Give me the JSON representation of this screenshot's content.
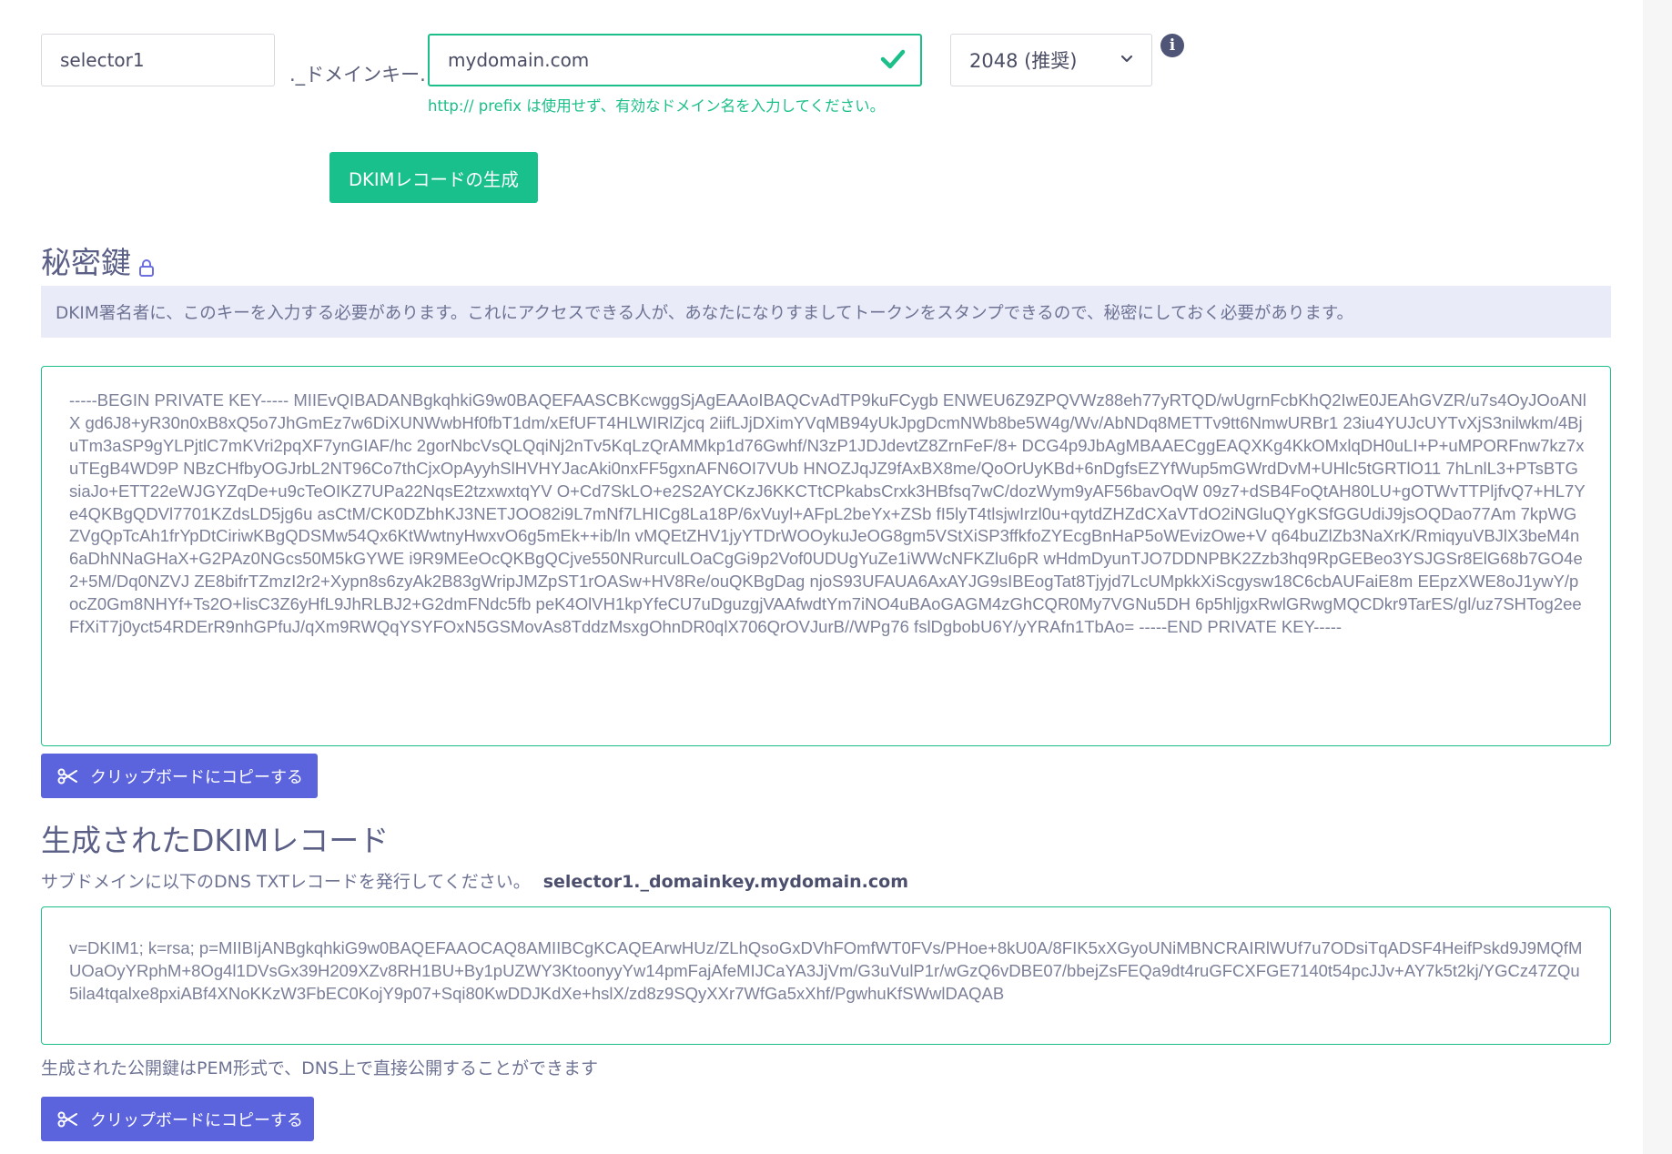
{
  "form": {
    "selector_value": "selector1",
    "domainkey_suffix": "._ドメインキー.",
    "domain_value": "mydomain.com",
    "domain_hint": "http:// prefix は使用せず、有効なドメイン名を入力してください。",
    "key_size_selected": "2048 (推奨)",
    "info_icon_glyph": "i",
    "generate_button_label": "DKIMレコードの生成"
  },
  "private_key_section": {
    "title": "秘密鍵",
    "notice": "DKIM署名者に、このキーを入力する必要があります。これにアクセスできる人が、あなたになりすましてトークンをスタンプできるので、秘密にしておく必要があります。",
    "key_text": "-----BEGIN PRIVATE KEY----- MIIEvQIBADANBgkqhkiG9w0BAQEFAASCBKcwggSjAgEAAoIBAQCvAdTP9kuFCygb ENWEU6Z9ZPQVWz88eh77yRTQD/wUgrnFcbKhQ2IwE0JEAhGVZR/u7s4OyJOoANlX gd6J8+yR30n0xB8xQ5o7JhGmEz7w6DiXUNWwbHf0fbT1dm/xEfUFT4HLWIRlZjcq 2iifLJjDXimYVqMB94yUkJpgDcmNWb8be5W4g/Wv/AbNDq8METTv9tt6NmwURBr1 23iu4YUJcUYTvXjS3nilwkm/4BjuTm3aSP9gYLPjtlC7mKVri2pqXF7ynGIAF/hc 2gorNbcVsQLQqiNj2nTv5KqLzQrAMMkp1d76Gwhf/N3zP1JDJdevtZ8ZrnFeF/8+ DCG4p9JbAgMBAAECggEAQXKg4KkOMxlqDH0uLI+P+uMPORFnw7kz7xuTEgB4WD9P NBzCHfbyOGJrbL2NT96Co7thCjxOpAyyhSlHVHYJacAki0nxFF5gxnAFN6OI7VUb HNOZJqJZ9fAxBX8me/QoOrUyKBd+6nDgfsEZYfWup5mGWrdDvM+UHlc5tGRTlO11 7hLnlL3+PTsBTGsiaJo+ETT22eWJGYZqDe+u9cTeOIKZ7UPa22NqsE2tzxwxtqYV O+Cd7SkLO+e2S2AYCKzJ6KKCTtCPkabsCrxk3HBfsq7wC/dozWym9yAF56bavOqW 09z7+dSB4FoQtAH80LU+gOTWvTTPljfvQ7+HL7Ye4QKBgQDVl7701KZdsLD5jg6u asCtM/CK0DZbhKJ3NETJOO82i9L7mNf7LHICg8La18P/6xVuyl+AFpL2beYx+ZSb fI5lyT4tlsjwIrzl0u+qytdZHZdCXaVTdO2iNGluQYgKSfGGUdiJ9jsOQDao77Am 7kpWGZVgQpTcAh1frYpDtCiriwKBgQDSMw54Qx6KtWwtnyHwxvO6g5mEk++ib/ln vMQEtZHV1jyYTDrWOOykuJeOG8gm5VStXiSP3ffkfoZYEcgBnHaP5oWEvizOwe+V q64buZlZb3NaXrK/RmiqyuVBJlX3beM4n6aDhNNaGHaX+G2PAz0NGcs50M5kGYWE i9R9MEeOcQKBgQCjve550NRurculLOaCgGi9p2Vof0UDUgYuZe1iWWcNFKZlu6pR wHdmDyunTJO7DDNPBK2Zzb3hq9RpGEBeo3YSJGSr8ElG68b7GO4e2+5M/Dq0NZVJ ZE8bifrTZmzI2r2+Xypn8s6zyAk2B83gWripJMZpST1rOASw+HV8Re/ouQKBgDag njoS93UFAUA6AxAYJG9sIBEogTat8Tjyjd7LcUMpkkXiScgysw18C6cbAUFaiE8m EEpzXWE8oJ1ywY/pocZ0Gm8NHYf+Ts2O+lisC3Z6yHfL9JhRLBJ2+G2dmFNdc5fb peK4OlVH1kpYfeCU7uDguzgjVAAfwdtYm7iNO4uBAoGAGM4zGhCQR0My7VGNu5DH 6p5hljgxRwlGRwgMQCDkr9TarES/gl/uz7SHTog2eeFfXiT7j0yct54RDErR9nhGPfuJ/qXm9RWQqYSYFOxN5GSMovAs8TddzMsxgOhnDR0qlX706QrOVJurB//WPg76 fslDgbobU6Y/yYRAfn1TbAo= -----END PRIVATE KEY-----",
    "copy_button_label": "クリップボードにコピーする"
  },
  "dkim_section": {
    "title": "生成されたDKIMレコード",
    "instruction": "サブドメインに以下のDNS TXTレコードを発行してください。",
    "record_host": "selector1._domainkey.mydomain.com",
    "record_text": "v=DKIM1; k=rsa; p=MIIBIjANBgkqhkiG9w0BAQEFAAOCAQ8AMIIBCgKCAQEArwHUz/ZLhQsoGxDVhFOmfWT0FVs/PHoe+8kU0A/8FIK5xXGyoUNiMBNCRAIRlWUf7u7ODsiTqADSF4HeifPskd9J9MQfMUOaOyYRphM+8Og4l1DVsGx39H209XZv8RH1BU+By1pUZWY3KtoonyyYw14pmFajAfeMIJCaYA3JjVm/G3uVulP1r/wGzQ6vDBE07/bbejZsFEQa9dt4ruGFCXFGE7140t54pcJJv+AY7k5t2kj/YGCz47ZQu5ila4tqalxe8pxiABf4XNoKKzW3FbEC0KojY9p07+Sqi80KwDDJKdXe+hslX/zd8z9SQyXXr7WfGa5xXhf/PgwhuKfSWwlDAQAB",
    "footer_note": "生成された公開鍵はPEM形式で、DNS上で直接公開することができます",
    "copy_button_label": "クリップボードにコピーする"
  },
  "colors": {
    "accent_green": "#1cbf8a",
    "button_blue": "#5b63dd",
    "notice_bg": "#e9ebf8",
    "heading": "#5b5f86"
  }
}
